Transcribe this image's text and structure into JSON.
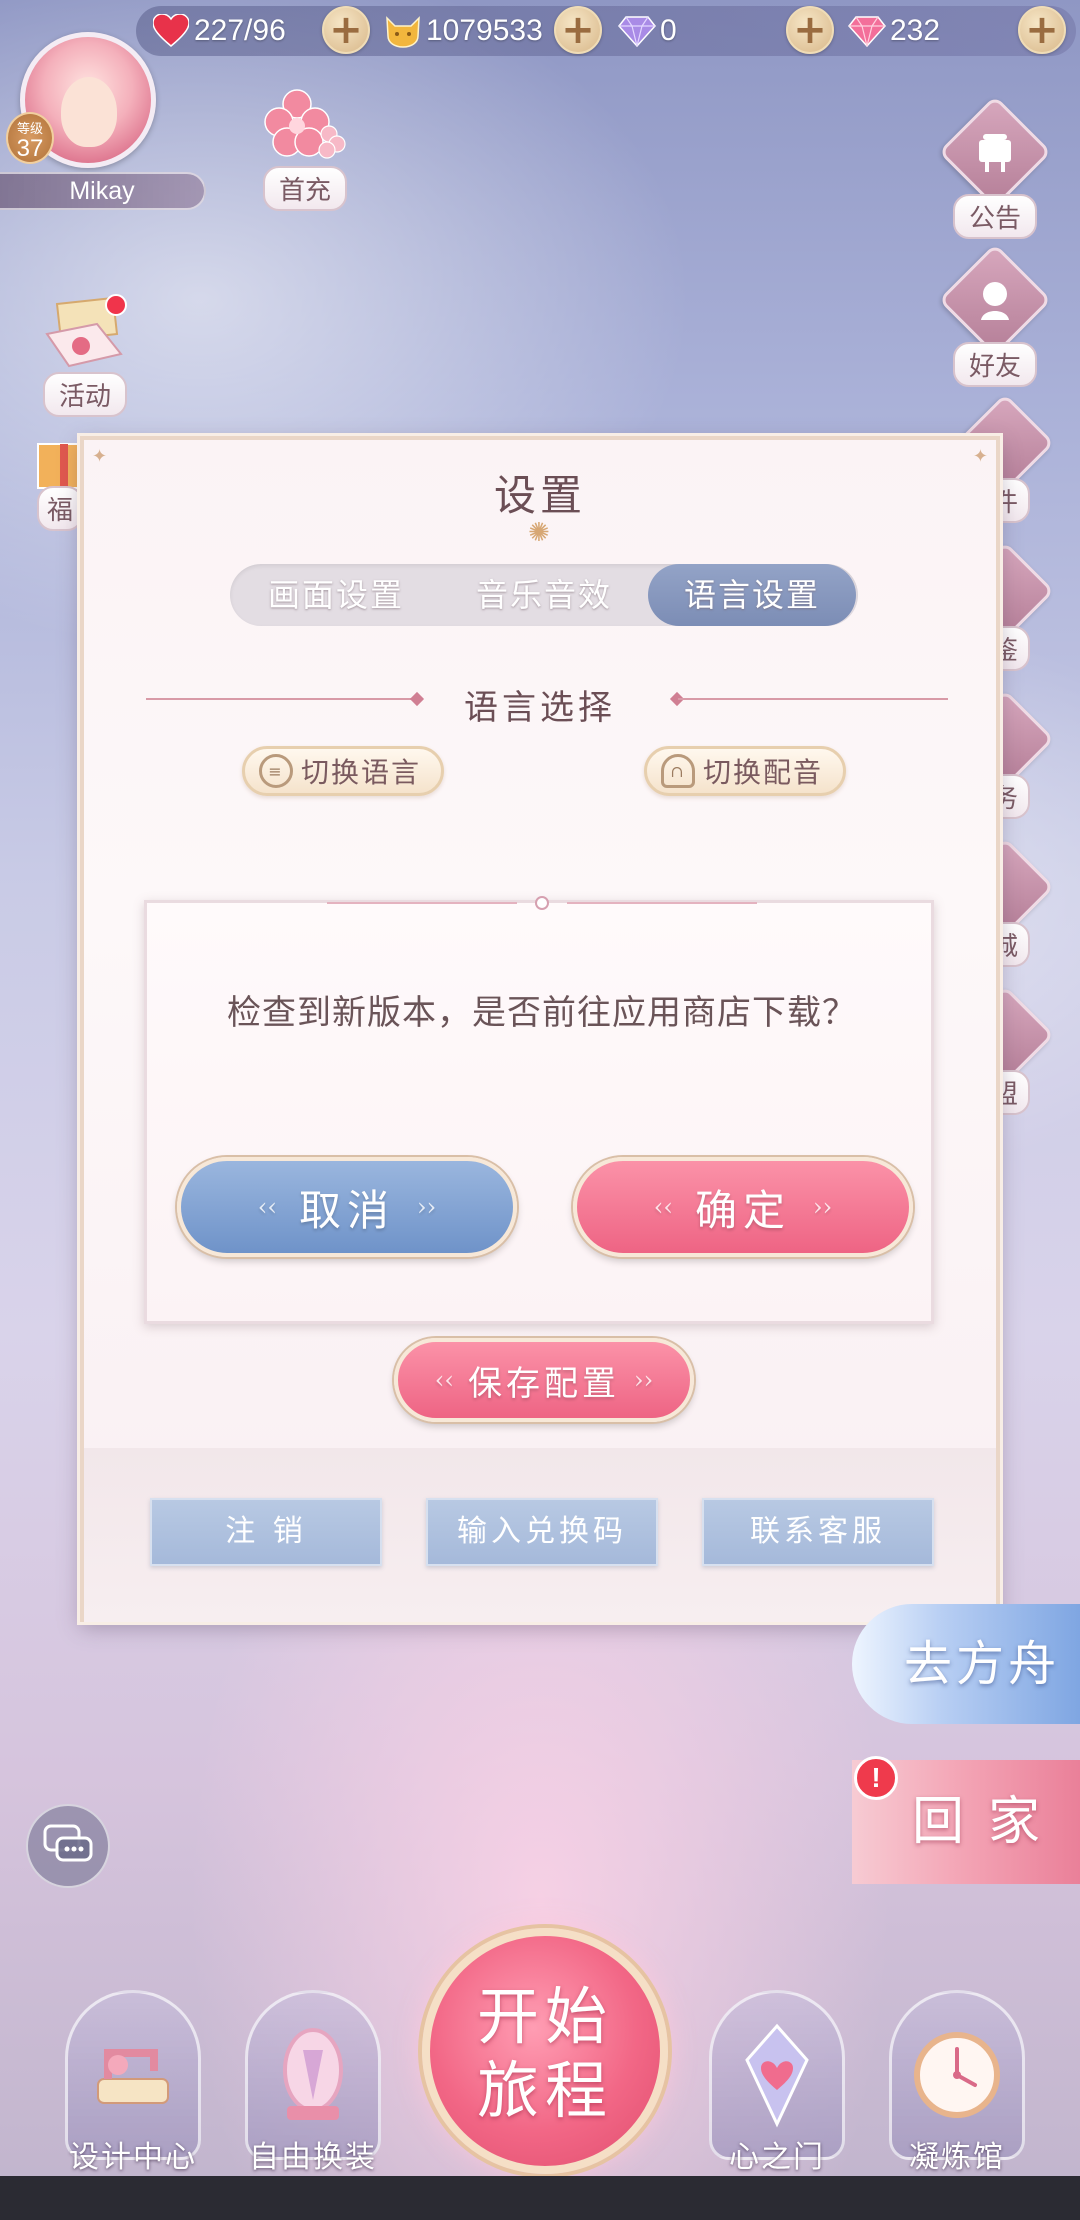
{
  "resources": {
    "stamina": "227/96",
    "gold": "1079533",
    "diamond": "0",
    "crystal": "232"
  },
  "player": {
    "level_label": "等级",
    "level": "37",
    "name": "Mikay"
  },
  "left_menu": {
    "first_charge": "首充",
    "activity": "活动",
    "welfare": "福"
  },
  "right_menu": {
    "notice": "公告",
    "friends": "好友",
    "mail_partial": "件",
    "album_partial": "鉴",
    "task_partial": "务",
    "shop_partial": "城",
    "alliance_partial": "盟"
  },
  "settings": {
    "title": "设置",
    "tabs": [
      "画面设置",
      "音乐音效",
      "语言设置"
    ],
    "active_tab": "语言设置",
    "section_title": "语言选择",
    "switch_language": "切换语言",
    "switch_voice": "切换配音",
    "save_label": "保存配置",
    "footer": {
      "logout": "注 销",
      "redeem": "输入兑换码",
      "support": "联系客服"
    }
  },
  "dialog": {
    "message": "检查到新版本，是否前往应用商店下载？",
    "cancel_label": "取消",
    "confirm_label": "确定"
  },
  "shortcuts": {
    "ark": "去方舟",
    "home": "回家"
  },
  "dock": {
    "start_line1": "开始",
    "start_line2": "旅程",
    "design_center": "设计中心",
    "free_dress": "自由换装",
    "heart_gate": "心之门",
    "refinery": "凝炼馆"
  },
  "colors": {
    "accent_pink": "#ee6484",
    "accent_blue": "#7c8db5",
    "panel_bg": "#fbf3f5"
  }
}
